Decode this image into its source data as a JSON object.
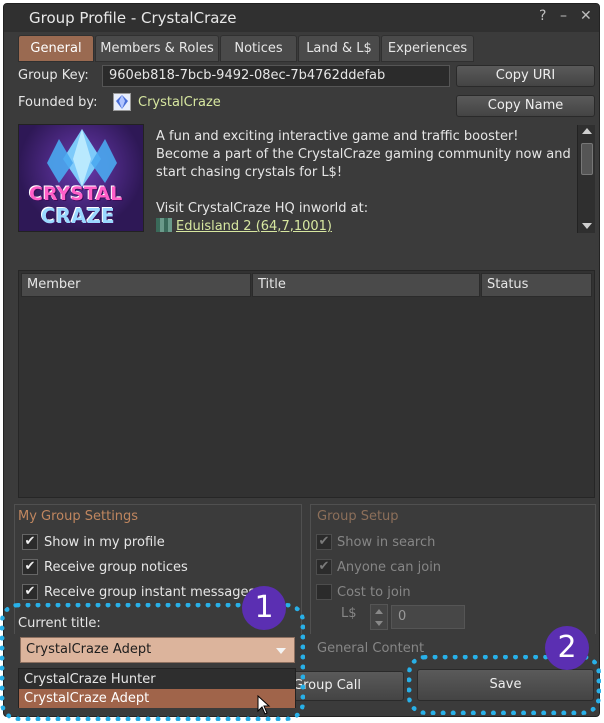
{
  "window": {
    "title": "Group Profile - CrystalCraze",
    "help_glyph": "?",
    "minimize_glyph": "–",
    "close_glyph": "✕"
  },
  "tabs": [
    {
      "label": "General",
      "active": true
    },
    {
      "label": "Members & Roles"
    },
    {
      "label": "Notices"
    },
    {
      "label": "Land & L$"
    },
    {
      "label": "Experiences"
    }
  ],
  "group": {
    "key_label": "Group Key:",
    "key_value": "960eb818-7bcb-9492-08ec-7b4762ddefab",
    "copy_uri_label": "Copy URI",
    "founded_label": "Founded by:",
    "founder_name": "CrystalCraze",
    "copy_name_label": "Copy Name",
    "logo_text_line1": "CRYSTAL",
    "logo_text_line2": "CRAZE",
    "description_lines": [
      "A fun and exciting interactive game and traffic booster!",
      "Become a part of the CrystalCraze gaming community now and",
      "start chasing crystals for L$!",
      "",
      "Visit CrystalCraze HQ inworld at:"
    ],
    "location_link": "Eduisland 2 (64,7,1001)"
  },
  "members_table": {
    "columns": [
      "Member",
      "Title",
      "Status"
    ]
  },
  "my_settings": {
    "title": "My Group Settings",
    "options": [
      {
        "label": "Show in my profile",
        "checked": true
      },
      {
        "label": "Receive group notices",
        "checked": true
      },
      {
        "label": "Receive group instant messages",
        "checked": true
      }
    ],
    "current_title_label": "Current title:",
    "current_title_value": "CrystalCraze Adept",
    "title_options": [
      "CrystalCraze Hunter",
      "CrystalCraze Adept"
    ]
  },
  "group_setup": {
    "title": "Group Setup",
    "options": [
      {
        "label": "Show in search",
        "checked": true
      },
      {
        "label": "Anyone can join",
        "checked": true
      },
      {
        "label": "Cost to join",
        "checked": false
      }
    ],
    "currency_label": "L$",
    "cost_value": "0",
    "general_content_label": "General Content"
  },
  "buttons": {
    "group_call_label": "Group Call",
    "save_label": "Save"
  },
  "callouts": {
    "one": "1",
    "two": "2",
    "color": "#28b0e8",
    "badge_color": "#5b2fb2"
  }
}
